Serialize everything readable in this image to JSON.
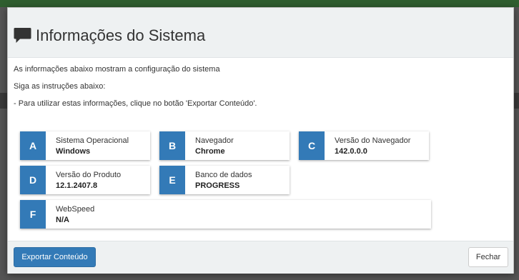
{
  "dialog": {
    "title": "Informações do Sistema",
    "intro": [
      "As informações abaixo mostram a configuração do sistema",
      "Siga as instruções abaixo:",
      "- Para utilizar estas informações, clique no botão 'Exportar Conteúdo'."
    ],
    "cards": [
      {
        "letter": "A",
        "label": "Sistema Operacional",
        "value": "Windows"
      },
      {
        "letter": "B",
        "label": "Navegador",
        "value": "Chrome"
      },
      {
        "letter": "C",
        "label": "Versão do Navegador",
        "value": "142.0.0.0"
      },
      {
        "letter": "D",
        "label": "Versão do Produto",
        "value": "12.1.2407.8"
      },
      {
        "letter": "E",
        "label": "Banco de dados",
        "value": "PROGRESS"
      },
      {
        "letter": "F",
        "label": "WebSpeed",
        "value": "N/A"
      }
    ],
    "export_button": "Exportar Conteúdo",
    "close_button": "Fechar"
  },
  "colors": {
    "accent": "#337ab7",
    "header_bg": "#eef1f2",
    "backdrop": "#555555"
  },
  "icons": {
    "title": "comment-icon"
  }
}
